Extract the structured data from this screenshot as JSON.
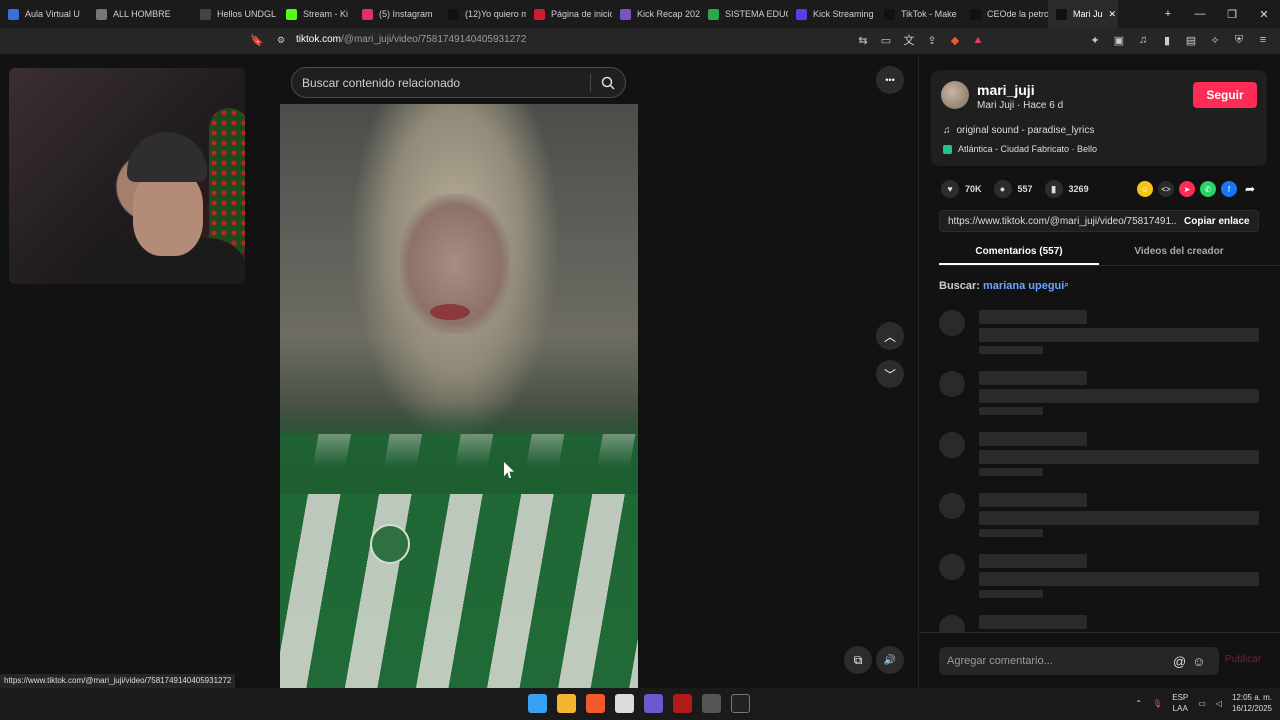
{
  "browser": {
    "tabs": [
      {
        "label": "Aula Virtual U",
        "color": "#3d6fd8"
      },
      {
        "label": "ALL HOMBRE",
        "color": "#777777"
      },
      {
        "label": "Hellos UNDGL",
        "color": "#444444"
      },
      {
        "label": "Stream - Ki",
        "color": "#53fc18"
      },
      {
        "label": "(5) Instagram",
        "color": "#e1306c"
      },
      {
        "label": "(12)Yo quiero m",
        "color": "#111111"
      },
      {
        "label": "Página de inicio",
        "color": "#cc1f2d"
      },
      {
        "label": "Kick Recap 202",
        "color": "#7a53c5"
      },
      {
        "label": "SISTEMA EDUC",
        "color": "#2aa84a"
      },
      {
        "label": "Kick Streaming",
        "color": "#5a3de6"
      },
      {
        "label": "TikTok - Make",
        "color": "#111111"
      },
      {
        "label": "CEOde la petro",
        "color": "#111111"
      },
      {
        "label": "Mari Ju",
        "color": "#111111",
        "active": true
      }
    ],
    "url_host": "tiktok.com",
    "url_path": "/@mari_juji/video/7581749140405931272",
    "new_tab": "+",
    "minimize": "—",
    "restore": "❐",
    "close": "✕"
  },
  "search": {
    "placeholder": "Buscar contenido relacionado"
  },
  "video_controls": {
    "more": "•••",
    "prev": "︿",
    "next": "﹀",
    "volume": "🔊",
    "pip": "⧉"
  },
  "creator": {
    "username": "mari_juji",
    "subtitle": "Mari Juji · Hace 6 d",
    "follow_label": "Seguir",
    "music": "original sound - paradise_lyrics",
    "music_icon": "♫",
    "location": "Atlántica - Ciudad Fabricato · Bello"
  },
  "stats": {
    "likes": "70K",
    "comments": "557",
    "saves": "3269"
  },
  "share": {
    "link": "https://www.tiktok.com/@mari_juji/video/75817491...",
    "copy_label": "Copiar enlace"
  },
  "tabs": {
    "comments": "Comentarios (557)",
    "creator_videos": "Videos del creador"
  },
  "search_hint": {
    "prefix": "Buscar:",
    "term": "mariana upegui"
  },
  "composer": {
    "placeholder": "Agregar comentario...",
    "mention": "@",
    "emoji": "☺",
    "publish": "Publicar"
  },
  "status_url": "https://www.tiktok.com/@mari_juji/video/7581749140405931272",
  "taskbar": {
    "lang_top": "ESP",
    "lang_bottom": "LAA",
    "time": "12:05 a. m.",
    "date": "16/12/2025"
  },
  "colors": {
    "follow": "#fe2c55",
    "search_term": "#6aa5ff"
  }
}
